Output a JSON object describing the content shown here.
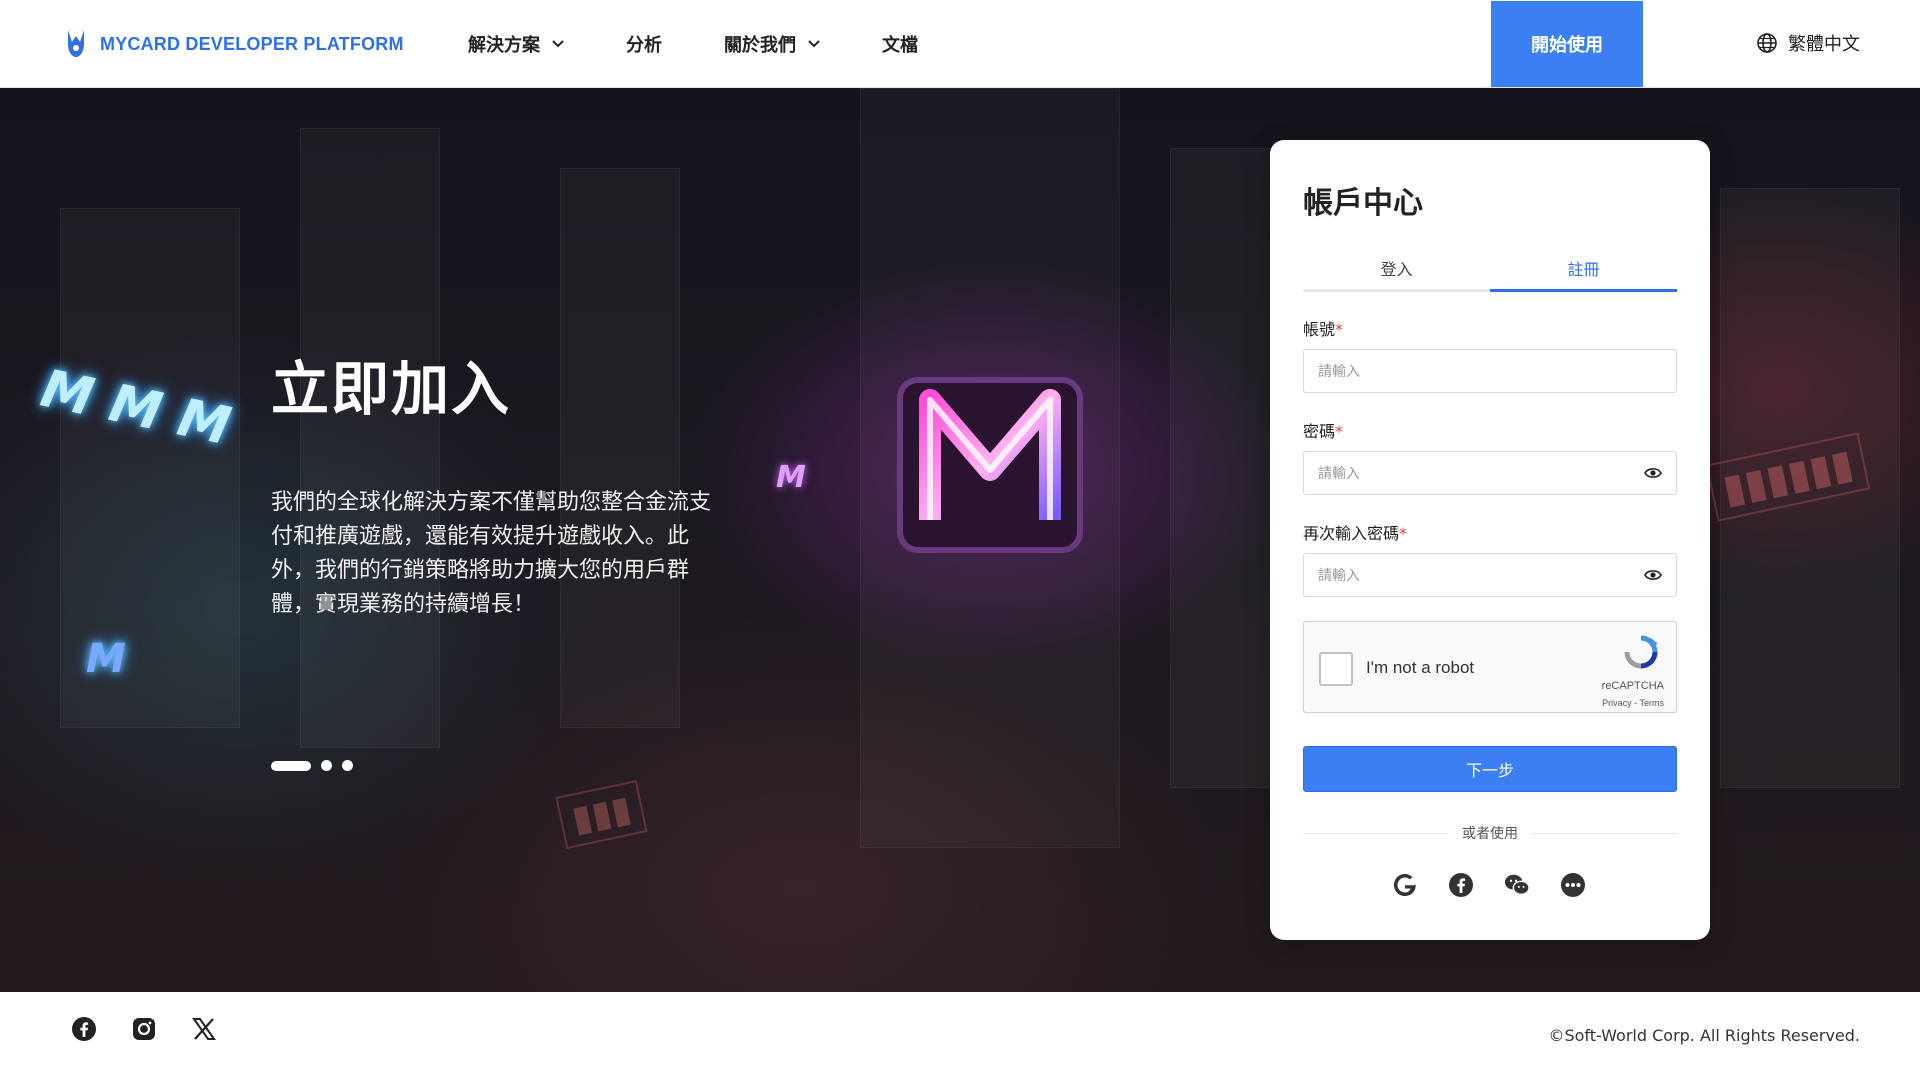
{
  "header": {
    "brand": "MYCARD DEVELOPER PLATFORM",
    "nav": [
      {
        "label": "解決方案",
        "has_dropdown": true
      },
      {
        "label": "分析",
        "has_dropdown": false
      },
      {
        "label": "關於我們",
        "has_dropdown": true
      },
      {
        "label": "文檔",
        "has_dropdown": false
      }
    ],
    "cta_label": "開始使用",
    "language": "繁體中文"
  },
  "hero": {
    "title": "立即加入",
    "description": "我們的全球化解決方案不僅幫助您整合金流支付和推廣遊戲，還能有效提升遊戲收入。此外，我們的行銷策略將助力擴大您的用戶群體，實現業務的持續增長！",
    "slides_total": 3,
    "slide_active": 1
  },
  "card": {
    "title": "帳戶中心",
    "tabs": [
      {
        "label": "登入",
        "active": false
      },
      {
        "label": "註冊",
        "active": true
      }
    ],
    "fields": [
      {
        "label": "帳號",
        "placeholder": "請輸入",
        "required": true,
        "has_eye": false
      },
      {
        "label": "密碼",
        "placeholder": "請輸入",
        "required": true,
        "has_eye": true
      },
      {
        "label": "再次輸入密碼",
        "placeholder": "請輸入",
        "required": true,
        "has_eye": true
      }
    ],
    "captcha": {
      "label": "I'm not a robot",
      "brand": "reCAPTCHA",
      "links": "Privacy - Terms"
    },
    "submit_label": "下一步",
    "divider_text": "或者使用",
    "social_logins": [
      "google-icon",
      "facebook-icon",
      "wechat-icon",
      "more-icon"
    ]
  },
  "footer": {
    "social_links": [
      "facebook-icon",
      "instagram-icon",
      "x-icon"
    ],
    "copyright": "©Soft-World Corp. All Rights Reserved."
  },
  "colors": {
    "primary": "#3b7ff2",
    "brand_text": "#2f6fe8",
    "required": "#e0443e"
  }
}
